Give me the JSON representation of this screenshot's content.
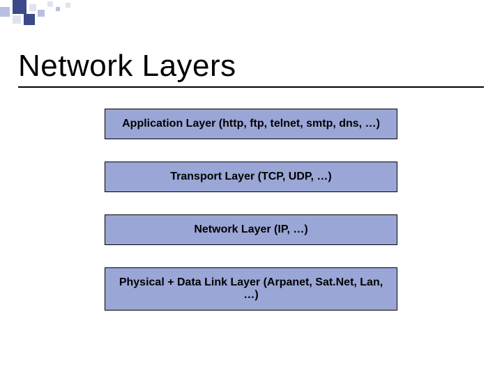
{
  "title": "Network Layers",
  "layers": [
    {
      "label": "Application Layer (http, ftp, telnet, smtp, dns, …)"
    },
    {
      "label": "Transport Layer (TCP, UDP, …)"
    },
    {
      "label": "Network Layer (IP, …)"
    },
    {
      "label": "Physical + Data Link Layer (Arpanet, Sat.Net, Lan, …)"
    }
  ],
  "colors": {
    "box_fill": "#9aa6d6",
    "accent_dark": "#3a4a8a",
    "accent_mid": "#b8c0e0",
    "accent_light": "#dfe3f0"
  }
}
